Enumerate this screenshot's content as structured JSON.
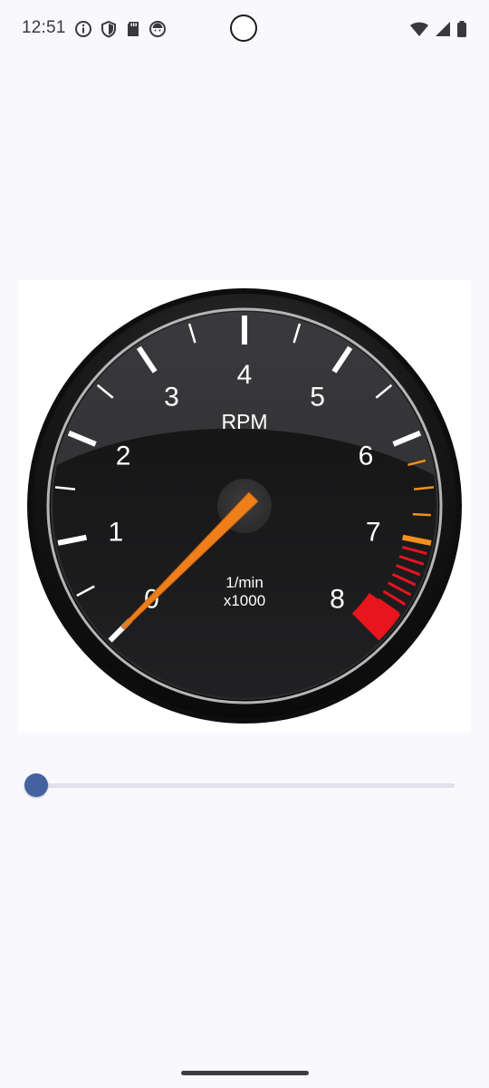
{
  "status_bar": {
    "time": "12:51",
    "left_icons": [
      "info-icon",
      "shield-icon",
      "sd-card-icon",
      "notification-face-icon"
    ],
    "right_icons": [
      "wifi-icon",
      "cellular-signal-icon",
      "battery-icon"
    ]
  },
  "gauge": {
    "title": "RPM",
    "unit_line1": "1/min",
    "unit_line2": "x1000",
    "scale_labels": [
      "0",
      "1",
      "2",
      "3",
      "4",
      "5",
      "6",
      "7",
      "8"
    ],
    "min": 0,
    "max": 8,
    "needle_value": 0,
    "caution_from": 6,
    "redline_from": 7,
    "colors": {
      "face": "#1d1d1f",
      "needle": "#ef7f1a",
      "caution": "#f3901d",
      "redline": "#e8141e",
      "ticks": "#ffffff"
    }
  },
  "slider": {
    "value_fraction": 0.0,
    "thumb_color": "#44629f",
    "track_color": "#e2e0ec"
  }
}
